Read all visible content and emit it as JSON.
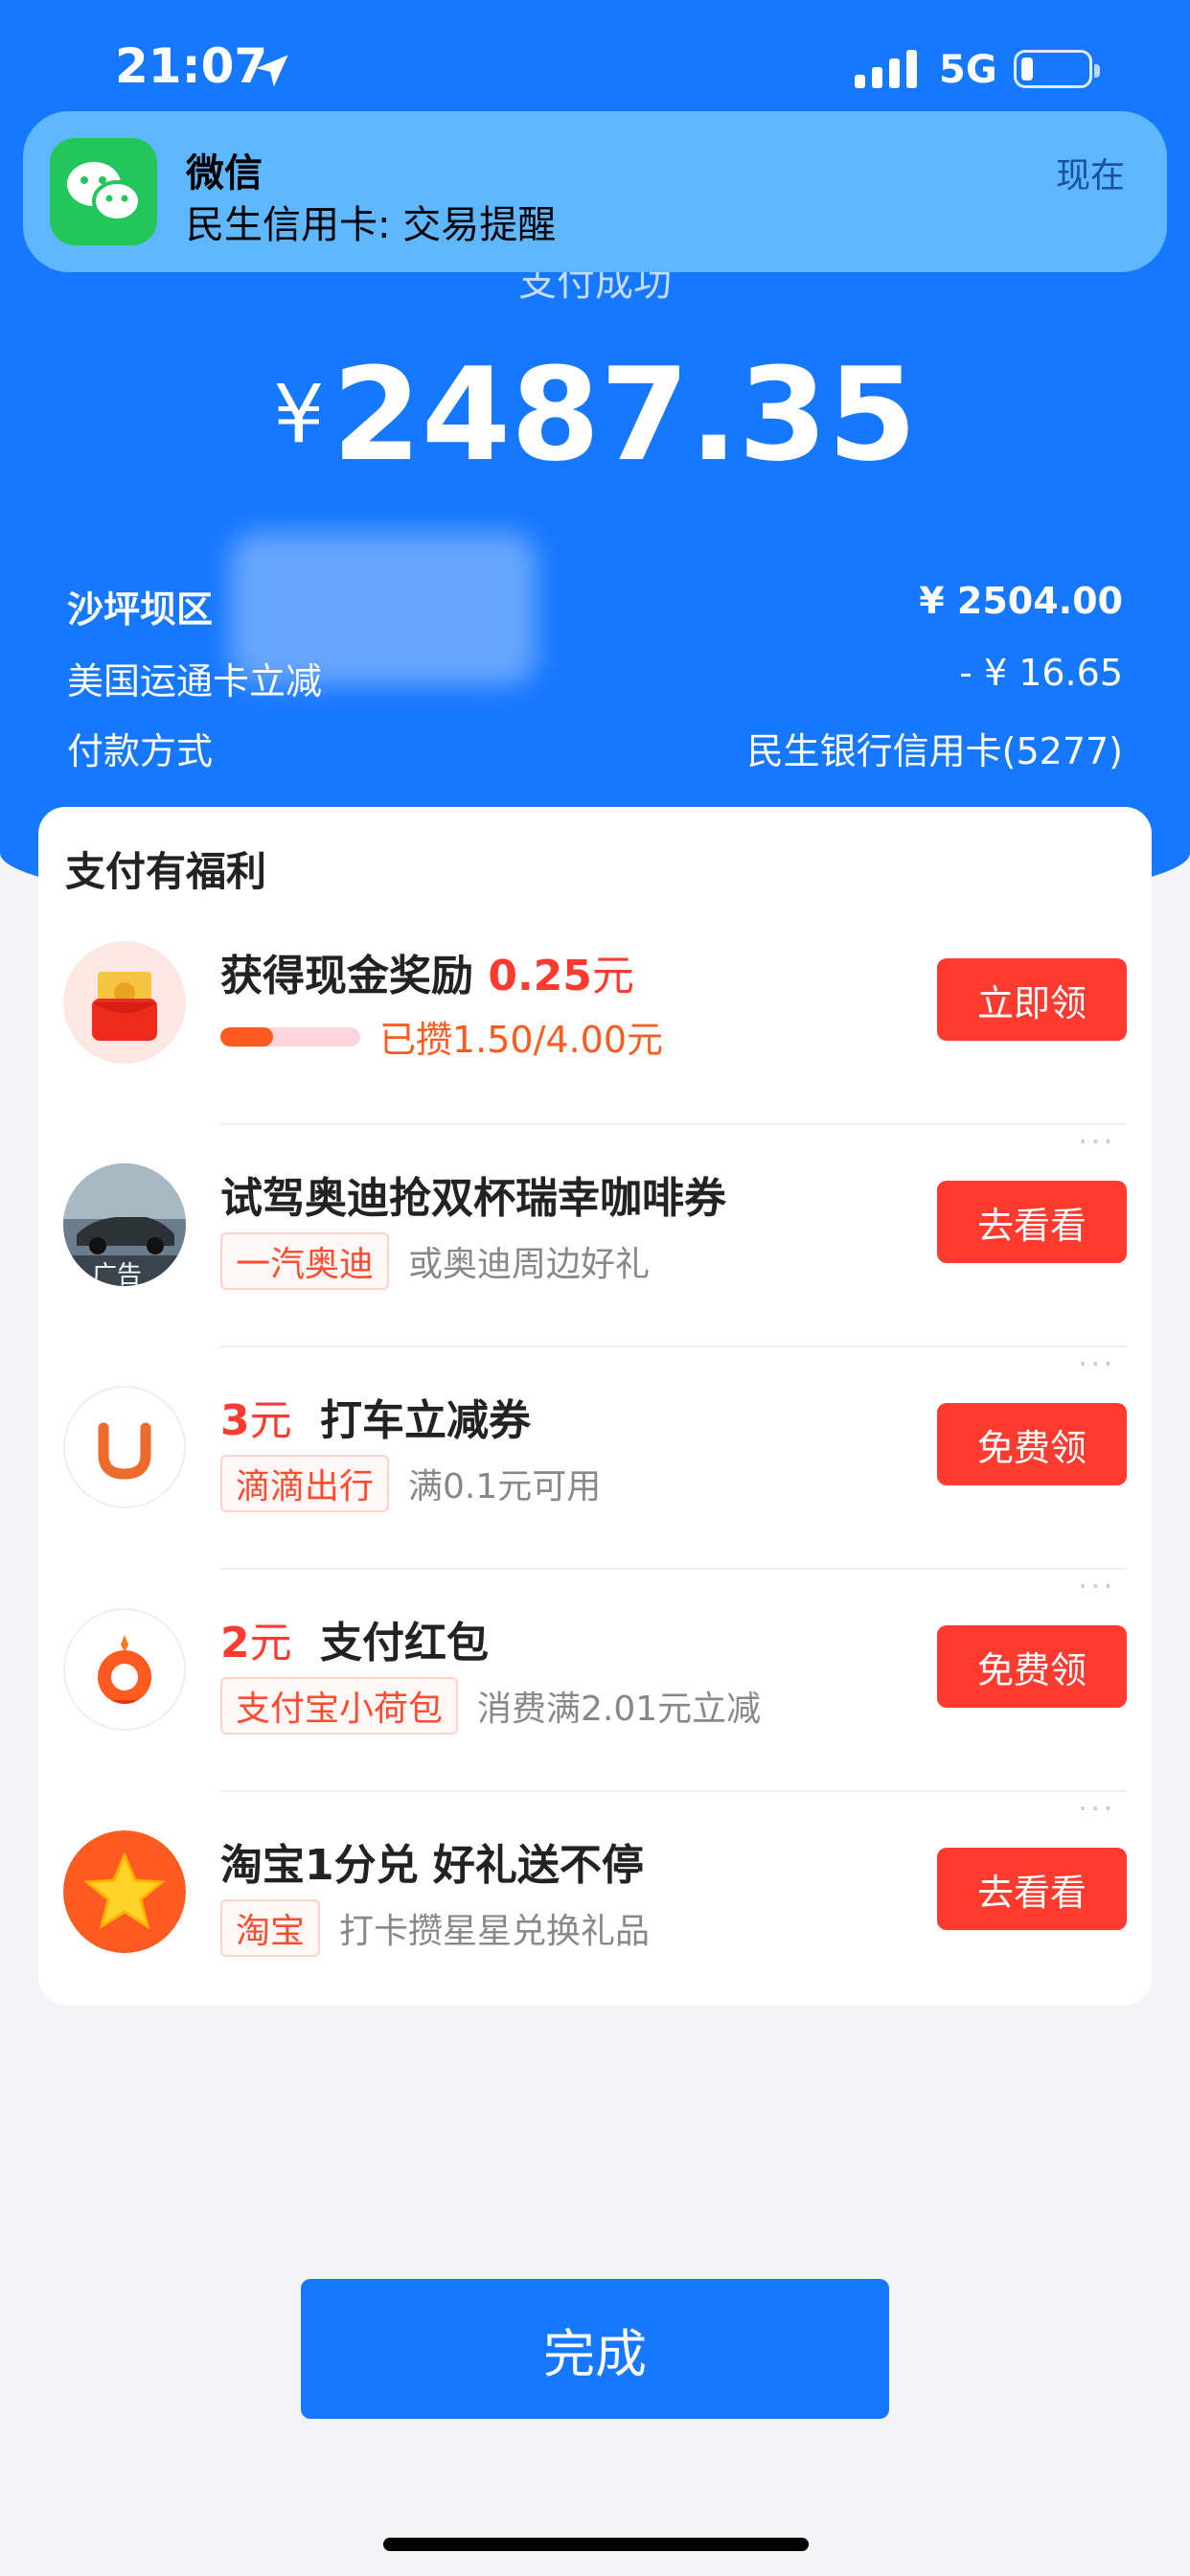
{
  "status_bar": {
    "time": "21:07",
    "network": "5G"
  },
  "notification": {
    "app": "微信",
    "message": "民生信用卡: 交易提醒",
    "time": "现在"
  },
  "payment": {
    "title": "支付成功",
    "currency": "¥",
    "amount": "2487.35",
    "merchant_label": "沙坪坝区",
    "merchant_amount": "¥ 2504.00",
    "discount_label": "美国运通卡立减",
    "discount_amount": "- ¥ 16.65",
    "method_label": "付款方式",
    "method_value": "民生银行信用卡(5277)"
  },
  "benefits": {
    "title": "支付有福利",
    "items": [
      {
        "prefix": "获得现金奖励",
        "highlight": "0.25",
        "unit": "元",
        "progress": 0.375,
        "progress_text": "已攒1.50/4.00元",
        "button": "立即领"
      },
      {
        "title": "试驾奥迪抢双杯瑞幸咖啡券",
        "tag": "一汽奥迪",
        "desc": "或奥迪周边好礼",
        "ad_label": "广告",
        "button": "去看看",
        "dots": "···"
      },
      {
        "highlight": "3",
        "unit": "元",
        "title": "打车立减券",
        "tag": "滴滴出行",
        "desc": "满0.1元可用",
        "button": "免费领",
        "dots": "···"
      },
      {
        "highlight": "2",
        "unit": "元",
        "title": "支付红包",
        "tag": "支付宝小荷包",
        "desc": "消费满2.01元立减",
        "button": "免费领",
        "dots": "···"
      },
      {
        "title": "淘宝1分兑 好礼送不停",
        "tag": "淘宝",
        "desc": "打卡攒星星兑换礼品",
        "button": "去看看",
        "dots": "···"
      }
    ]
  },
  "done_button": "完成",
  "colors": {
    "brand_blue": "#1677ff",
    "accent_red": "#ff3b30"
  }
}
